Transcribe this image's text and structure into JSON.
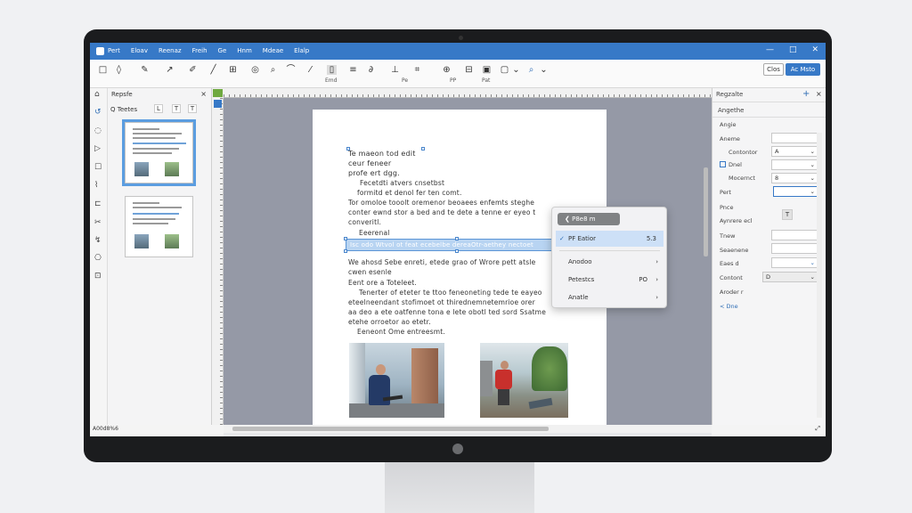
{
  "window": {
    "menu": [
      "Pert",
      "Eloav",
      "Reenaz",
      "Freih",
      "Ge",
      "Hnm",
      "Mdeae",
      "Elalp"
    ],
    "controls": [
      "—",
      "□",
      "✕"
    ]
  },
  "toolbar": {
    "labels": [
      "Emd",
      "Pe",
      "PP",
      "Pat"
    ],
    "close_label": "Clos",
    "primary_label": "Ac Msto"
  },
  "left_panel": {
    "title": "Repsfe",
    "close": "×",
    "tab_label": "Q Teetes",
    "tools": [
      "L",
      "T",
      "T"
    ]
  },
  "document": {
    "lines": [
      "Te maeon tod edit",
      "ceur feneer",
      "profe ert dgg.",
      "Fecetdti atvers cnsetbst",
      "formitd et denol fer ten comt.",
      "Tor omoloe tooolt oremenor beoaees enfemts steghe",
      "conter ewnd stor a bed and te dete a tenne er eyeo t",
      "converitl.",
      "Eeerenal",
      "Isc odo Wtvol ot feat ecebelbe dereaOtr-aethey nectoet",
      "We ahosd Sebe enreti, etede grao of Wrore pett atsle",
      "cwen esenle",
      "Eent ore a Toteleet.",
      "Tenerter of eteter te ttoo feneoneting tede te eayeo",
      "eteelneendant stofimoet ot thirednemnetemrioe orer",
      "aa deo a ete oatfenne tona e lete obotl ted sord Ssatme",
      "etehe orroetor ao etetr.",
      "Eeneont Ome entreesmt."
    ]
  },
  "context_menu": {
    "header": "P8e8 m",
    "items": [
      {
        "label": "PF Eatior",
        "shortcut": "5.3",
        "checked": true
      },
      {
        "label": "Anodoo",
        "arrow": "›"
      },
      {
        "label": "Petestcs",
        "shortcut": "PO",
        "arrow": "›"
      },
      {
        "label": "Anatle",
        "arrow": "›"
      }
    ]
  },
  "right_panel": {
    "title": "Regzalte",
    "add": "+",
    "close": "×",
    "section": "Angethe",
    "labels": [
      "Angie",
      "Aneme",
      "Contontor",
      "Dnel",
      "Mocernct",
      "Pert",
      "Pnce",
      "Aynrere ecl",
      "Tnew",
      "Seaenene",
      "Eaes d",
      "Contont",
      "Aroder r"
    ],
    "field_values": [
      "",
      "A",
      "",
      "8",
      "",
      "",
      "",
      "",
      "D",
      ""
    ],
    "link": "< Dne"
  },
  "status": {
    "text": "A00d8%6"
  }
}
